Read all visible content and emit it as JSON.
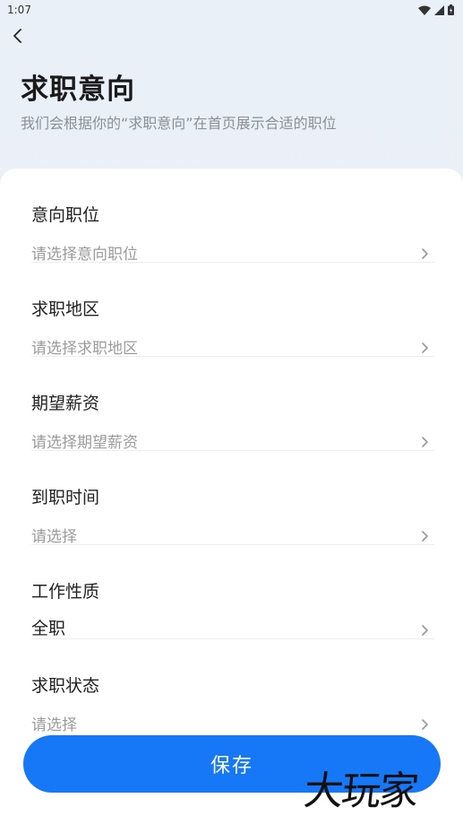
{
  "status_bar": {
    "time": "1:07"
  },
  "header": {
    "title": "求职意向",
    "subtitle": "我们会根据你的“求职意向”在首页展示合适的职位"
  },
  "form": {
    "rows": [
      {
        "label": "意向职位",
        "value": "请选择意向职位",
        "filled": false
      },
      {
        "label": "求职地区",
        "value": "请选择求职地区",
        "filled": false
      },
      {
        "label": "期望薪资",
        "value": "请选择期望薪资",
        "filled": false
      },
      {
        "label": "到职时间",
        "value": "请选择",
        "filled": false
      },
      {
        "label": "工作性质",
        "value": "全职",
        "filled": true
      },
      {
        "label": "求职状态",
        "value": "请选择",
        "filled": false
      }
    ]
  },
  "actions": {
    "save_label": "保存"
  },
  "watermark": "大玩家",
  "colors": {
    "accent": "#1677f7",
    "placeholder": "#9b9b9b",
    "background": "#eaf0f8"
  },
  "icons": {
    "back": "back-arrow-icon",
    "chevron": "chevron-right-icon",
    "wifi": "wifi-icon",
    "signal": "signal-icon",
    "battery": "battery-icon"
  }
}
